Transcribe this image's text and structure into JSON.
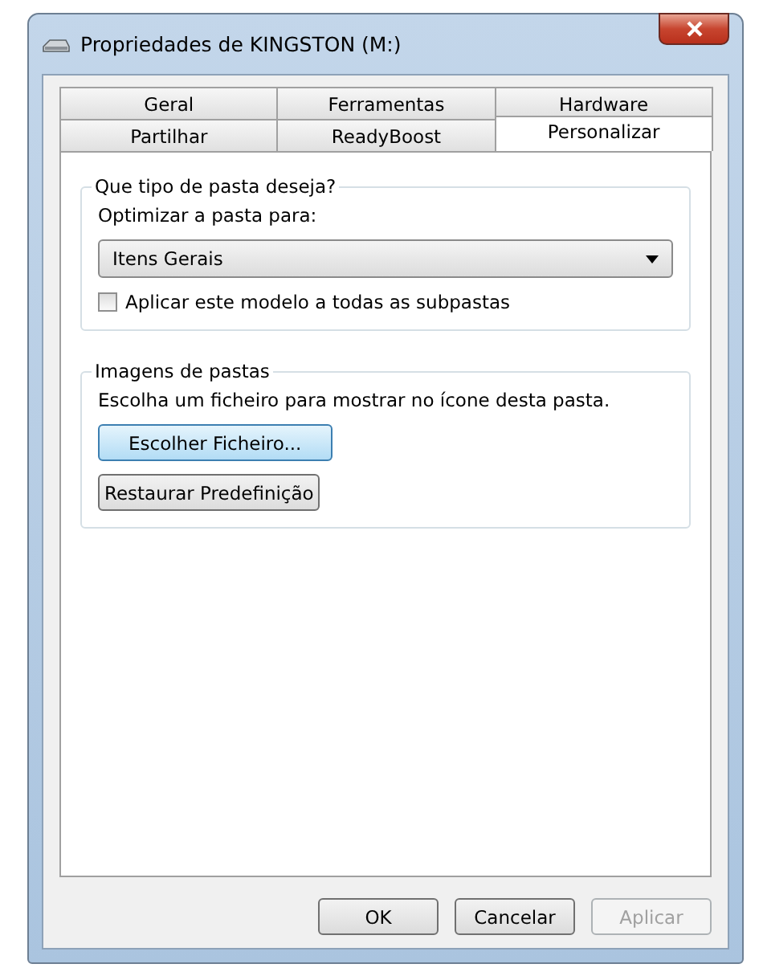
{
  "window": {
    "title": "Propriedades de KINGSTON (M:)"
  },
  "tab_rows": [
    [
      {
        "label": "Geral",
        "selected": false
      },
      {
        "label": "Ferramentas",
        "selected": false
      },
      {
        "label": "Hardware",
        "selected": false
      }
    ],
    [
      {
        "label": "Partilhar",
        "selected": false
      },
      {
        "label": "ReadyBoost",
        "selected": false
      },
      {
        "label": "Personalizar",
        "selected": true
      }
    ]
  ],
  "folder_type": {
    "title": "Que tipo de pasta deseja?",
    "label": "Optimizar a pasta para:",
    "dropdown": {
      "value": "Itens Gerais"
    },
    "checkbox": {
      "label": "Aplicar este modelo a todas as subpastas",
      "checked": false
    }
  },
  "folder_images": {
    "title": "Imagens de pastas",
    "description": "Escolha um ficheiro para mostrar no ícone desta pasta.",
    "buttons": [
      {
        "label": "Escolher Ficheiro...",
        "focused": true
      },
      {
        "label": "Restaurar Predefinição",
        "focused": false
      }
    ]
  },
  "buttons": [
    {
      "label": "OK",
      "disabled": false
    },
    {
      "label": "Cancelar",
      "disabled": false
    },
    {
      "label": "Aplicar",
      "disabled": true
    }
  ]
}
